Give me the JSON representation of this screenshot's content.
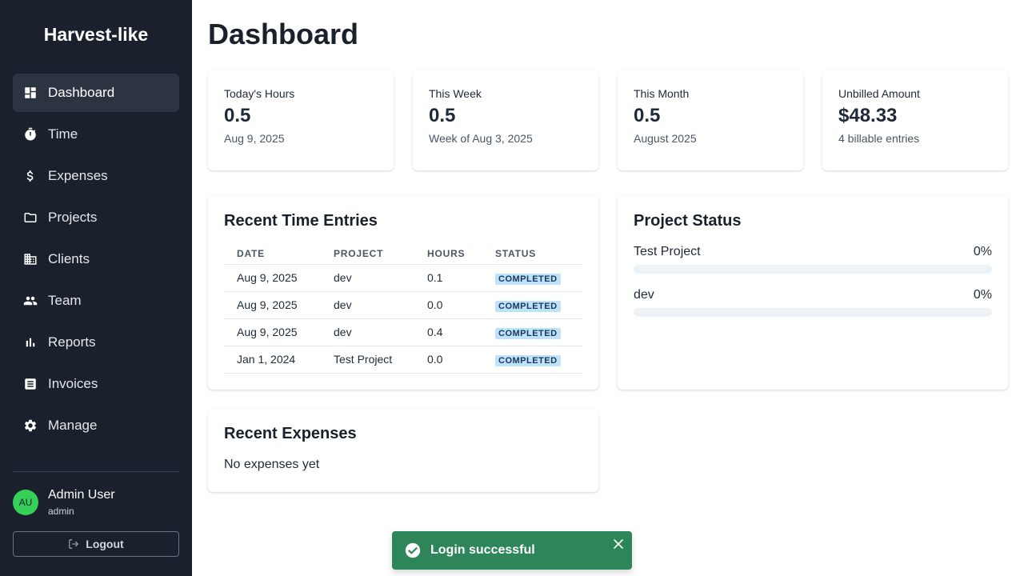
{
  "brand": "Harvest-like",
  "nav": [
    {
      "label": "Dashboard",
      "icon": "dashboard-icon",
      "active": true
    },
    {
      "label": "Time",
      "icon": "stopwatch-icon"
    },
    {
      "label": "Expenses",
      "icon": "dollar-icon"
    },
    {
      "label": "Projects",
      "icon": "folder-icon"
    },
    {
      "label": "Clients",
      "icon": "building-icon"
    },
    {
      "label": "Team",
      "icon": "people-icon"
    },
    {
      "label": "Reports",
      "icon": "bar-chart-icon"
    },
    {
      "label": "Invoices",
      "icon": "invoice-icon"
    },
    {
      "label": "Manage",
      "icon": "gear-icon"
    }
  ],
  "user": {
    "initials": "AU",
    "name": "Admin User",
    "role": "admin",
    "avatar_color": "#34d058"
  },
  "logout_label": "Logout",
  "page_title": "Dashboard",
  "stats": [
    {
      "label": "Today's Hours",
      "value": "0.5",
      "sub": "Aug 9, 2025"
    },
    {
      "label": "This Week",
      "value": "0.5",
      "sub": "Week of Aug 3, 2025"
    },
    {
      "label": "This Month",
      "value": "0.5",
      "sub": "August 2025"
    },
    {
      "label": "Unbilled Amount",
      "value": "$48.33",
      "sub": "4 billable entries"
    }
  ],
  "recent_entries": {
    "title": "Recent Time Entries",
    "columns": [
      "DATE",
      "PROJECT",
      "HOURS",
      "STATUS"
    ],
    "rows": [
      {
        "date": "Aug 9, 2025",
        "project": "dev",
        "hours": "0.1",
        "status": "COMPLETED"
      },
      {
        "date": "Aug 9, 2025",
        "project": "dev",
        "hours": "0.0",
        "status": "COMPLETED"
      },
      {
        "date": "Aug 9, 2025",
        "project": "dev",
        "hours": "0.4",
        "status": "COMPLETED"
      },
      {
        "date": "Jan 1, 2024",
        "project": "Test Project",
        "hours": "0.0",
        "status": "COMPLETED"
      }
    ]
  },
  "project_status": {
    "title": "Project Status",
    "projects": [
      {
        "name": "Test Project",
        "percent_label": "0%",
        "percent": 0
      },
      {
        "name": "dev",
        "percent_label": "0%",
        "percent": 0
      }
    ]
  },
  "recent_expenses": {
    "title": "Recent Expenses",
    "empty": "No expenses yet"
  },
  "toast": {
    "message": "Login successful",
    "color": "#2f855a"
  },
  "colors": {
    "sidebar": "#1a202c",
    "badge_bg": "#bee3f8",
    "badge_text": "#1a365d"
  }
}
